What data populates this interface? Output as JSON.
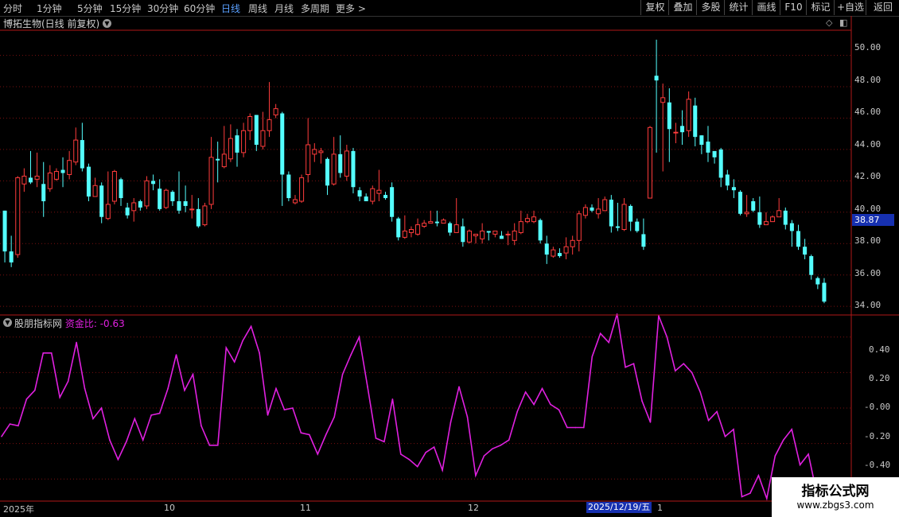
{
  "periods": [
    "分时",
    "1分钟",
    "5分钟",
    "15分钟",
    "30分钟",
    "60分钟",
    "日线",
    "周线",
    "月线",
    "多周期",
    "更多 >"
  ],
  "active_period": "日线",
  "toolbar": [
    "复权",
    "叠加",
    "多股",
    "统计",
    "画线",
    "F10",
    "标记",
    "+自选",
    "返回"
  ],
  "chart_title": "博拓生物(日线 前复权)",
  "indicator": {
    "source": "股朋指标网",
    "name": "资金比:",
    "value": "-0.63"
  },
  "price_axis": [
    "50.00",
    "48.00",
    "46.00",
    "44.00",
    "42.00",
    "40.00",
    "38.00",
    "36.00",
    "34.00"
  ],
  "current_price": "38.87",
  "indicator_axis": [
    "0.40",
    "0.20",
    "-0.00",
    "-0.20",
    "-0.40"
  ],
  "dates": [
    "2025年",
    "10",
    "11",
    "12",
    "1"
  ],
  "cursor_date": "2025/12/19/五",
  "watermark": {
    "line1": "指标公式网",
    "line2": "www.zbgs3.com"
  },
  "colors": {
    "up": "#ff3c3c",
    "down": "#54ffff",
    "indicator": "#e020e0",
    "grid": "#7a1010"
  },
  "chart_data": {
    "type": "candlestick",
    "title": "博拓生物(日线 前复权)",
    "price_ylim": [
      33.5,
      51.5
    ],
    "candles": [
      [
        40.1,
        37.5,
        40.1,
        36.8
      ],
      [
        37.5,
        36.8,
        38.5,
        36.5
      ],
      [
        37.3,
        42.2,
        42.3,
        37.1
      ],
      [
        41.8,
        42.3,
        42.8,
        41.3
      ],
      [
        42.2,
        41.9,
        43.9,
        41.8
      ],
      [
        42.1,
        42.3,
        43.8,
        41.6
      ],
      [
        41.8,
        40.7,
        43.2,
        39.7
      ],
      [
        41.5,
        42.5,
        43.0,
        41.3
      ],
      [
        42.1,
        42.6,
        42.8,
        42.0
      ],
      [
        42.7,
        42.5,
        43.5,
        41.6
      ],
      [
        42.4,
        43.3,
        43.9,
        42.1
      ],
      [
        43.2,
        44.6,
        45.4,
        43.0
      ],
      [
        44.6,
        42.8,
        45.7,
        42.6
      ],
      [
        42.9,
        41.0,
        43.1,
        40.7
      ],
      [
        41.0,
        41.7,
        42.2,
        41.0
      ],
      [
        41.7,
        39.7,
        41.9,
        39.3
      ],
      [
        39.6,
        40.5,
        42.6,
        39.5
      ],
      [
        40.7,
        42.6,
        42.7,
        40.5
      ],
      [
        42.1,
        40.9,
        42.2,
        40.4
      ],
      [
        40.3,
        39.8,
        40.6,
        39.6
      ],
      [
        40.1,
        40.6,
        40.9,
        39.4
      ],
      [
        40.7,
        40.3,
        40.8,
        40.1
      ],
      [
        40.4,
        42.0,
        42.3,
        40.2
      ],
      [
        42.0,
        41.8,
        42.4,
        41.4
      ],
      [
        41.5,
        40.2,
        42.1,
        40.1
      ],
      [
        40.3,
        41.4,
        41.5,
        40.2
      ],
      [
        41.3,
        40.7,
        41.4,
        40.4
      ],
      [
        40.7,
        40.1,
        42.6,
        39.9
      ],
      [
        40.7,
        40.4,
        41.7,
        40.0
      ],
      [
        40.2,
        40.2,
        41.1,
        39.6
      ],
      [
        40.2,
        39.1,
        40.9,
        39.0
      ],
      [
        39.2,
        40.4,
        40.6,
        39.1
      ],
      [
        40.5,
        43.5,
        44.8,
        40.2
      ],
      [
        43.4,
        43.3,
        44.5,
        41.9
      ],
      [
        42.9,
        43.7,
        45.5,
        42.8
      ],
      [
        43.4,
        44.7,
        45.6,
        43.2
      ],
      [
        44.9,
        43.8,
        45.3,
        42.9
      ],
      [
        43.8,
        45.2,
        45.7,
        43.5
      ],
      [
        45.2,
        46.1,
        46.3,
        44.6
      ],
      [
        46.2,
        44.3,
        46.2,
        43.9
      ],
      [
        44.2,
        45.2,
        46.4,
        44.0
      ],
      [
        45.2,
        45.9,
        48.3,
        44.8
      ],
      [
        46.2,
        46.6,
        46.9,
        46.0
      ],
      [
        46.3,
        42.4,
        46.4,
        40.4
      ],
      [
        42.4,
        40.9,
        42.6,
        40.7
      ],
      [
        40.6,
        40.8,
        41.1,
        40.5
      ],
      [
        40.7,
        42.2,
        42.4,
        40.6
      ],
      [
        42.4,
        44.3,
        46.0,
        41.9
      ],
      [
        43.7,
        44.0,
        44.4,
        43.2
      ],
      [
        43.8,
        43.9,
        44.1,
        43.1
      ],
      [
        43.4,
        41.7,
        43.5,
        41.1
      ],
      [
        41.8,
        43.7,
        44.8,
        41.7
      ],
      [
        43.7,
        42.5,
        44.9,
        42.2
      ],
      [
        42.3,
        43.9,
        44.3,
        42.0
      ],
      [
        43.9,
        41.6,
        44.1,
        41.2
      ],
      [
        41.4,
        41.0,
        41.6,
        40.7
      ],
      [
        41.0,
        40.7,
        41.2,
        40.7
      ],
      [
        40.7,
        41.5,
        41.7,
        40.5
      ],
      [
        41.2,
        41.4,
        42.7,
        40.7
      ],
      [
        41.1,
        40.9,
        41.3,
        40.8
      ],
      [
        41.6,
        39.7,
        41.9,
        39.4
      ],
      [
        39.6,
        38.4,
        39.7,
        38.2
      ],
      [
        38.4,
        38.8,
        39.8,
        38.3
      ],
      [
        38.7,
        38.9,
        39.1,
        38.4
      ],
      [
        38.6,
        39.2,
        39.6,
        38.5
      ],
      [
        39.1,
        39.3,
        39.5,
        39.0
      ],
      [
        39.3,
        39.4,
        40.1,
        39.3
      ],
      [
        39.4,
        39.3,
        40.1,
        39.1
      ],
      [
        39.3,
        39.5,
        39.6,
        39.4
      ],
      [
        39.3,
        38.7,
        39.4,
        38.5
      ],
      [
        38.7,
        39.2,
        40.9,
        38.7
      ],
      [
        39.1,
        38.1,
        39.6,
        37.8
      ],
      [
        38.1,
        38.8,
        38.9,
        38.0
      ],
      [
        38.5,
        38.6,
        38.6,
        38.0
      ],
      [
        38.3,
        38.8,
        39.3,
        38.0
      ],
      [
        38.8,
        38.7,
        38.8,
        38.2
      ],
      [
        38.6,
        38.8,
        38.8,
        38.4
      ],
      [
        38.5,
        38.3,
        38.8,
        38.3
      ],
      [
        38.6,
        38.6,
        38.8,
        37.9
      ],
      [
        38.2,
        38.8,
        39.3,
        37.9
      ],
      [
        38.7,
        39.4,
        40.1,
        38.6
      ],
      [
        39.4,
        39.6,
        39.9,
        39.3
      ],
      [
        39.4,
        39.7,
        40.1,
        39.3
      ],
      [
        39.5,
        38.2,
        39.6,
        38.0
      ],
      [
        38.0,
        37.3,
        38.5,
        36.7
      ],
      [
        37.2,
        37.6,
        37.8,
        37.1
      ],
      [
        37.4,
        37.2,
        37.7,
        37.1
      ],
      [
        37.4,
        37.8,
        38.4,
        37.0
      ],
      [
        37.8,
        38.2,
        38.5,
        37.3
      ],
      [
        38.2,
        39.9,
        40.1,
        37.5
      ],
      [
        39.8,
        40.3,
        40.5,
        39.6
      ],
      [
        40.3,
        40.1,
        40.5,
        40.0
      ],
      [
        39.9,
        40.2,
        40.9,
        39.6
      ],
      [
        40.1,
        40.8,
        41.0,
        40.1
      ],
      [
        40.8,
        39.1,
        41.1,
        38.7
      ],
      [
        39.1,
        39.0,
        40.6,
        38.8
      ],
      [
        38.9,
        40.5,
        40.9,
        38.8
      ],
      [
        40.4,
        39.4,
        40.5,
        38.8
      ],
      [
        39.4,
        38.8,
        39.6,
        38.7
      ],
      [
        38.6,
        37.8,
        39.6,
        37.6
      ],
      [
        40.9,
        45.4,
        45.5,
        40.9
      ],
      [
        48.7,
        48.4,
        51.0,
        43.8
      ],
      [
        47.0,
        47.3,
        48.2,
        42.6
      ],
      [
        47.0,
        45.3,
        47.9,
        43.2
      ],
      [
        45.1,
        45.1,
        45.7,
        44.4
      ],
      [
        45.5,
        45.1,
        46.5,
        44.3
      ],
      [
        45.2,
        47.2,
        47.7,
        44.8
      ],
      [
        46.8,
        44.8,
        47.3,
        44.2
      ],
      [
        44.9,
        44.3,
        44.9,
        43.7
      ],
      [
        44.5,
        43.8,
        45.5,
        43.2
      ],
      [
        43.9,
        43.5,
        43.8,
        43.1
      ],
      [
        44.0,
        42.2,
        44.1,
        41.6
      ],
      [
        42.4,
        41.7,
        42.7,
        41.4
      ],
      [
        41.6,
        41.4,
        42.1,
        40.9
      ],
      [
        41.3,
        39.9,
        41.4,
        39.8
      ],
      [
        39.9,
        40.0,
        41.1,
        39.7
      ],
      [
        40.7,
        40.1,
        40.9,
        40.0
      ],
      [
        40.0,
        39.2,
        41.0,
        39.0
      ],
      [
        39.2,
        39.4,
        40.0,
        39.2
      ],
      [
        39.4,
        39.7,
        39.8,
        39.4
      ],
      [
        39.7,
        40.1,
        40.9,
        39.7
      ],
      [
        40.1,
        39.2,
        40.3,
        38.9
      ],
      [
        39.3,
        38.8,
        39.5,
        37.8
      ],
      [
        38.8,
        37.8,
        39.2,
        37.6
      ],
      [
        37.8,
        37.3,
        38.3,
        37.0
      ],
      [
        37.2,
        36.0,
        37.3,
        35.7
      ],
      [
        35.8,
        35.4,
        35.9,
        35.1
      ],
      [
        35.5,
        34.3,
        35.8,
        34.2
      ]
    ],
    "indicator_series": {
      "name": "资金比",
      "ylim": [
        -0.52,
        0.52
      ],
      "values": [
        -0.16,
        -0.09,
        -0.1,
        0.05,
        0.1,
        0.31,
        0.31,
        0.06,
        0.15,
        0.37,
        0.11,
        -0.06,
        0.0,
        -0.18,
        -0.29,
        -0.19,
        -0.06,
        -0.18,
        -0.04,
        -0.03,
        0.11,
        0.3,
        0.1,
        0.19,
        -0.1,
        -0.21,
        -0.21,
        0.34,
        0.26,
        0.38,
        0.46,
        0.31,
        -0.04,
        0.11,
        -0.01,
        0.0,
        -0.14,
        -0.15,
        -0.26,
        -0.15,
        -0.05,
        0.19,
        0.3,
        0.4,
        0.12,
        -0.17,
        -0.19,
        0.05,
        -0.26,
        -0.29,
        -0.33,
        -0.25,
        -0.22,
        -0.35,
        -0.08,
        0.12,
        -0.05,
        -0.38,
        -0.27,
        -0.23,
        -0.21,
        -0.18,
        -0.02,
        0.09,
        0.02,
        0.11,
        0.02,
        -0.01,
        -0.11,
        -0.11,
        -0.11,
        0.29,
        0.42,
        0.37,
        0.53,
        0.23,
        0.25,
        0.04,
        -0.08,
        0.52,
        0.4,
        0.21,
        0.25,
        0.2,
        0.09,
        -0.07,
        -0.02,
        -0.16,
        -0.12,
        -0.5,
        -0.48,
        -0.38,
        -0.51,
        -0.27,
        -0.18,
        -0.12,
        -0.32,
        -0.26,
        -0.48,
        -0.62
      ]
    },
    "xlabel": "",
    "ylabel": ""
  }
}
